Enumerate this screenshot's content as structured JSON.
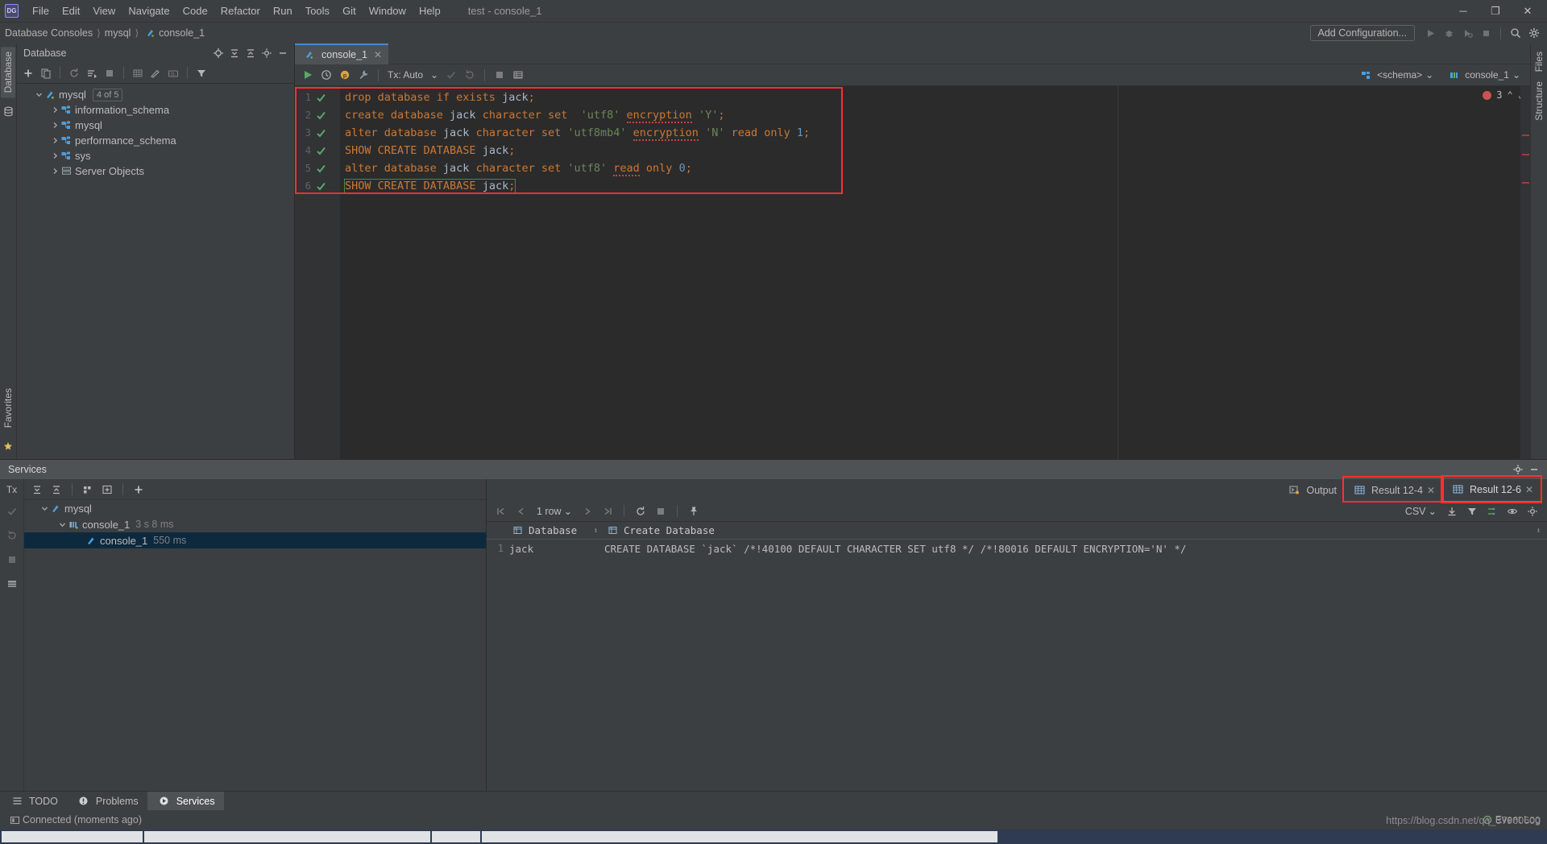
{
  "window": {
    "app_logo": "DG",
    "title": "test - console_1",
    "minimize": "─",
    "maximize": "❐",
    "close": "✕"
  },
  "menu": {
    "items": [
      {
        "label": "File"
      },
      {
        "label": "Edit"
      },
      {
        "label": "View"
      },
      {
        "label": "Navigate"
      },
      {
        "label": "Code"
      },
      {
        "label": "Refactor"
      },
      {
        "label": "Run"
      },
      {
        "label": "Tools"
      },
      {
        "label": "Git"
      },
      {
        "label": "Window"
      },
      {
        "label": "Help"
      }
    ]
  },
  "navbar": {
    "breadcrumb": [
      "Database Consoles",
      "mysql",
      "console_1"
    ],
    "add_configuration": "Add Configuration...",
    "icons": [
      "run-icon",
      "debug-icon",
      "run-coverage-icon",
      "stop-icon",
      "search-everywhere-icon",
      "settings-icon"
    ]
  },
  "left_strip": {
    "tabs": [
      "Database"
    ],
    "bottom_tabs": [
      "Favorites"
    ],
    "icon": "database-icon",
    "star_icon": "star-icon"
  },
  "right_strip": {
    "tabs": [
      "Files",
      "Structure"
    ]
  },
  "database_panel": {
    "title": "Database",
    "header_icons": [
      "locate-icon",
      "expand-all-icon",
      "collapse-all-icon",
      "settings-icon",
      "hide-icon"
    ],
    "toolbar_icons": [
      "add-icon",
      "copy-icon",
      "refresh-icon",
      "sync-icon",
      "stop-icon",
      "table-icon",
      "edit-icon",
      "query-console-icon",
      "filter-icon"
    ],
    "tree": [
      {
        "label": "mysql",
        "badge": "4 of 5",
        "indent": 0,
        "expanded": true,
        "icon": "datasource-icon"
      },
      {
        "label": "information_schema",
        "badge": "",
        "indent": 1,
        "expanded": false,
        "icon": "schema-icon"
      },
      {
        "label": "mysql",
        "badge": "",
        "indent": 1,
        "expanded": false,
        "icon": "schema-icon"
      },
      {
        "label": "performance_schema",
        "badge": "",
        "indent": 1,
        "expanded": false,
        "icon": "schema-icon"
      },
      {
        "label": "sys",
        "badge": "",
        "indent": 1,
        "expanded": false,
        "icon": "schema-icon"
      },
      {
        "label": "Server Objects",
        "badge": "",
        "indent": 1,
        "expanded": false,
        "icon": "server-objects-icon"
      }
    ]
  },
  "editor": {
    "tab_label": "console_1",
    "tab_icon": "console-icon",
    "tab_close": "✕",
    "toolbar": {
      "execute": "run-icon",
      "history": "history-icon",
      "params": "params-icon",
      "wrench": "wrench-icon",
      "tx_label": "Tx: Auto",
      "tx_caret": "⌄",
      "commit": "commit-icon",
      "rollback": "rollback-icon",
      "stop": "stop-icon",
      "grid": "grid-icon",
      "schema_chip": "<schema>",
      "session_chip": "console_1",
      "schema_icon": "schema-chip-icon",
      "session_icon": "session-chip-icon"
    },
    "inspection": {
      "error_count": "3",
      "up_arrow": "⌃",
      "down_arrow": "⌄"
    },
    "lines": [
      {
        "n": "1",
        "status": "ok",
        "tokens": [
          {
            "t": "drop database if exists ",
            "c": "kw"
          },
          {
            "t": "jack",
            "c": "id2"
          },
          {
            "t": ";",
            "c": "kw"
          }
        ]
      },
      {
        "n": "2",
        "status": "ok",
        "tokens": [
          {
            "t": "create database ",
            "c": "kw"
          },
          {
            "t": "jack",
            "c": "id2"
          },
          {
            "t": " character set  ",
            "c": "kw"
          },
          {
            "t": "'utf8'",
            "c": "str"
          },
          {
            "t": " ",
            "c": "kw"
          },
          {
            "t": "encryption",
            "c": "kw wavy"
          },
          {
            "t": " ",
            "c": "kw"
          },
          {
            "t": "'Y'",
            "c": "str"
          },
          {
            "t": ";",
            "c": "kw"
          }
        ]
      },
      {
        "n": "3",
        "status": "ok",
        "tokens": [
          {
            "t": "alter database ",
            "c": "kw"
          },
          {
            "t": "jack",
            "c": "id2"
          },
          {
            "t": " character set ",
            "c": "kw"
          },
          {
            "t": "'utf8mb4'",
            "c": "str"
          },
          {
            "t": " ",
            "c": "kw"
          },
          {
            "t": "encryption",
            "c": "kw wavy"
          },
          {
            "t": " ",
            "c": "kw"
          },
          {
            "t": "'N'",
            "c": "str"
          },
          {
            "t": " read only ",
            "c": "kw"
          },
          {
            "t": "1",
            "c": "num"
          },
          {
            "t": ";",
            "c": "kw"
          }
        ]
      },
      {
        "n": "4",
        "status": "ok",
        "tokens": [
          {
            "t": "SHOW CREATE DATABASE ",
            "c": "kw"
          },
          {
            "t": "jack",
            "c": "id2"
          },
          {
            "t": ";",
            "c": "kw"
          }
        ]
      },
      {
        "n": "5",
        "status": "ok",
        "tokens": [
          {
            "t": "alter database ",
            "c": "kw"
          },
          {
            "t": "jack",
            "c": "id2"
          },
          {
            "t": " character set ",
            "c": "kw"
          },
          {
            "t": "'utf8'",
            "c": "str"
          },
          {
            "t": " ",
            "c": "kw"
          },
          {
            "t": "read",
            "c": "kw wavy"
          },
          {
            "t": " only ",
            "c": "kw"
          },
          {
            "t": "0",
            "c": "num"
          },
          {
            "t": ";",
            "c": "kw"
          }
        ]
      },
      {
        "n": "6",
        "status": "ok",
        "tokens": [
          {
            "t": "SHOW CREATE DATABASE ",
            "c": "kw"
          },
          {
            "t": "jack",
            "c": "id2"
          },
          {
            "t": ";",
            "c": "kw"
          }
        ]
      }
    ]
  },
  "services": {
    "title": "Services",
    "header_icons": [
      "settings-icon",
      "hide-icon"
    ],
    "vtools": [
      "Tx",
      "commit-icon",
      "rollback-icon",
      "stop-icon",
      "grid-icon"
    ],
    "toolbar_icons": [
      "expand-all-icon",
      "collapse-all-icon",
      "group-icon",
      "add-frame-icon",
      "add-icon"
    ],
    "tree": [
      {
        "label": "mysql",
        "time": "",
        "indent": 0,
        "expanded": true,
        "icon": "datasource-icon",
        "selected": false
      },
      {
        "label": "console_1",
        "time": "3 s 8 ms",
        "indent": 1,
        "expanded": true,
        "icon": "session-icon",
        "selected": false
      },
      {
        "label": "console_1",
        "time": "550 ms",
        "indent": 2,
        "expanded": null,
        "icon": "console-icon",
        "selected": true
      }
    ]
  },
  "results": {
    "tabs": [
      {
        "label": "Output",
        "icon": "output-icon",
        "active": false,
        "closable": false,
        "highlighted": false
      },
      {
        "label": "Result 12-4",
        "icon": "table-icon",
        "active": false,
        "closable": true,
        "highlighted": true
      },
      {
        "label": "Result 12-6",
        "icon": "table-icon",
        "active": true,
        "closable": true,
        "highlighted": true
      }
    ],
    "grid_toolbar": {
      "first": "|◀",
      "prev": "◀",
      "row_count": "1 row",
      "caret": "⌄",
      "next": "▶",
      "last": "▶|",
      "reload": "reload-icon",
      "stop": "stop-icon",
      "pin": "pin-icon",
      "format": "CSV",
      "format_caret": "⌄",
      "export_icon": "export-icon",
      "filter-icon": "filter-icon",
      "transpose_icon": "transpose-icon",
      "preview_icon": "eye-icon",
      "settings_icon": "settings-icon"
    },
    "columns": [
      "Database",
      "Create Database"
    ],
    "rows": [
      {
        "index": "1",
        "Database": "jack",
        "Create Database": "CREATE DATABASE `jack` /*!40100 DEFAULT CHARACTER SET utf8 */ /*!80016 DEFAULT ENCRYPTION='N' */"
      }
    ]
  },
  "bottom_bar": {
    "tabs": [
      {
        "label": "TODO",
        "icon": "todo-icon",
        "selected": false
      },
      {
        "label": "Problems",
        "icon": "problems-icon",
        "selected": false
      },
      {
        "label": "Services",
        "icon": "services-icon",
        "selected": true
      }
    ]
  },
  "status_bar": {
    "icon": "connection-icon",
    "text": "Connected (moments ago)",
    "event_log": "Event Log",
    "event_log_icon": "event-log-icon",
    "watermark": "https://blog.csdn.net/qq_37960600"
  },
  "colors": {
    "background": "#3c3f41",
    "editor_background": "#2b2b2b",
    "accent_blue": "#4a88c7",
    "highlight_red": "#ff2f2f",
    "selection_blue": "#0d293e",
    "keyword_orange": "#cc7832",
    "string_green": "#6a8759",
    "number_blue": "#6897bb"
  }
}
